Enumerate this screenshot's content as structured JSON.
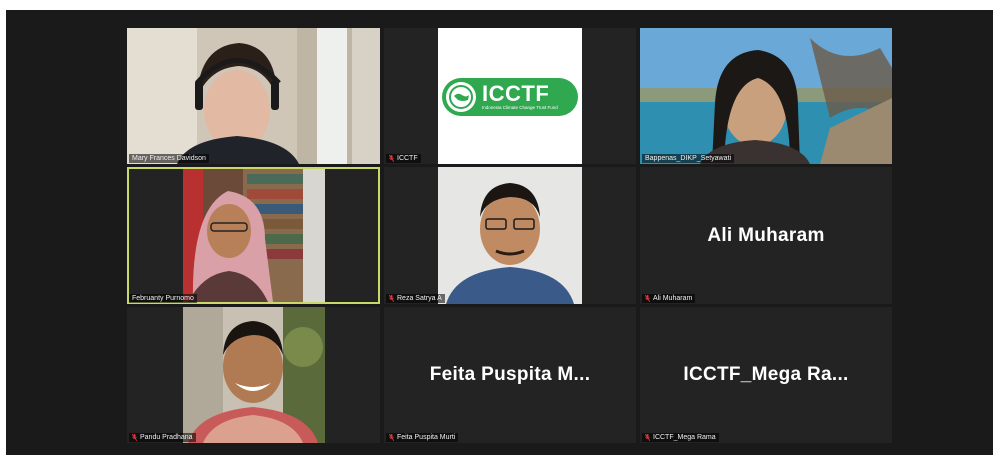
{
  "participants": [
    {
      "name": "Mary Frances Davidson",
      "muted": false
    },
    {
      "name": "ICCTF",
      "muted": true
    },
    {
      "name": "Bappenas_DIKP_Setyawati",
      "muted": false
    },
    {
      "name": "Februanty Purnomo",
      "muted": false,
      "active_speaker": true
    },
    {
      "name": "Reza Satrya A",
      "muted": true
    },
    {
      "name": "Ali Muharam",
      "muted": true,
      "display_label": "Ali Muharam"
    },
    {
      "name": "Pandu Pradhana",
      "muted": true
    },
    {
      "name": "Feita Puspita Murti",
      "muted": true,
      "display_label": "Feita Puspita M..."
    },
    {
      "name": "ICCTF_Mega Rama",
      "muted": true,
      "display_label": "ICCTF_Mega Ra..."
    }
  ],
  "logo": {
    "title": "ICCTF",
    "subtitle": "Indonesia Climate Change Trust Fund"
  },
  "colors": {
    "background": "#1a1a1a",
    "tile": "#232323",
    "active_border": "#c8d96a",
    "mute_icon": "#e0353b",
    "logo_green": "#2fa84f"
  }
}
